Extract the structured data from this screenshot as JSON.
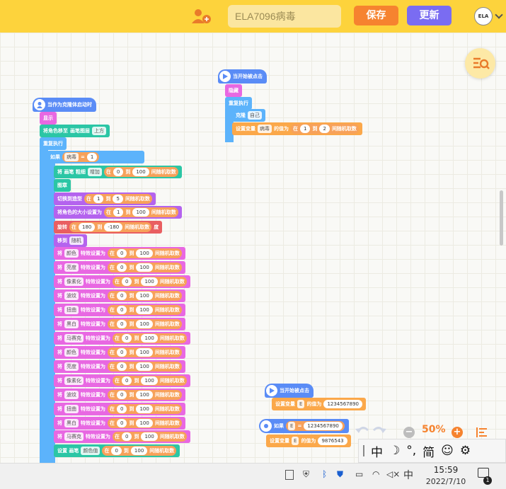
{
  "topbar": {
    "project_name": "ELA7096病毒",
    "save_label": "保存",
    "update_label": "更新",
    "avatar_text": "ELA"
  },
  "scripts": {
    "clone_start": "当作为克隆体启动时",
    "show": "显示",
    "move_layer_a": "将角色移至",
    "move_layer_b": "画笔图层",
    "layer_top": "上方",
    "forever": "重复执行",
    "if": "如果",
    "var_virus": "病毒",
    "eq": "=",
    "one": "1",
    "pen_set": "将 画笔 粗细",
    "add": "增加",
    "zero": "0",
    "hundred": "100",
    "at": "在",
    "to": "到",
    "rand": "间随机取数",
    "stamp": "图章",
    "switch_costume": "切换到造型",
    "five": "5",
    "set_size": "将角色的大小设置为",
    "turn": "旋转",
    "n180": "180",
    "nm180": "-180",
    "deg": "度",
    "goto": "移到",
    "random": "随机",
    "set_effect_pre": "将",
    "set_effect_post": "特效设置为",
    "fx_color": "颜色",
    "fx_bright": "亮度",
    "fx_pixel": "像素化",
    "fx_wave": "波纹",
    "fx_whirl": "扭曲",
    "fx_bw": "黑白",
    "fx_mosaic": "马赛克",
    "set_pen_color": "设置 画笔",
    "pen_color_dd": "颜色值",
    "click_start": "当开始被点击",
    "hide": "隐藏",
    "clone": "克隆",
    "myself": "自己",
    "set_var": "设置变量",
    "val_as": "的值为",
    "two": "2",
    "var_e": "E",
    "big1": "1234567890",
    "big2": "9876543"
  },
  "zoom": {
    "minus": "−",
    "value": "50%",
    "plus": "+"
  },
  "ime": {
    "lang": "中",
    "mode": "简",
    "punct": "°,"
  },
  "taskbar": {
    "ime_indicator": "中",
    "time": "15:59",
    "date": "2022/7/10",
    "notif_count": "1"
  }
}
